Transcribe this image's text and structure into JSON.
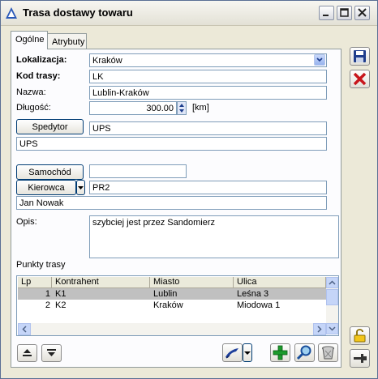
{
  "window": {
    "title": "Trasa dostawy towaru"
  },
  "tabs": [
    {
      "label": "Ogólne"
    },
    {
      "label": "Atrybuty"
    }
  ],
  "form": {
    "lokalizacja_label": "Lokalizacja:",
    "lokalizacja_value": "Kraków",
    "kod_label": "Kod trasy:",
    "kod_value": "LK",
    "nazwa_label": "Nazwa:",
    "nazwa_value": "Lublin-Kraków",
    "dlugosc_label": "Długość:",
    "dlugosc_value": "300.00",
    "dlugosc_unit": "[km]",
    "spedytor_button": "Spedytor",
    "spedytor_code": "UPS",
    "spedytor_name": "UPS",
    "samochod_button": "Samochód",
    "samochod_value": "",
    "kierowca_button": "Kierowca",
    "kierowca_code": "PR2",
    "kierowca_name": "Jan Nowak",
    "opis_label": "Opis:",
    "opis_value": "szybciej jest przez Sandomierz",
    "punkty_label": "Punkty trasy"
  },
  "grid": {
    "columns": [
      "Lp",
      "Kontrahent",
      "Miasto",
      "Ulica"
    ],
    "rows": [
      {
        "lp": "1",
        "kontrahent": "K1",
        "miasto": "Lublin",
        "ulica": "Leśna 3"
      },
      {
        "lp": "2",
        "kontrahent": "K2",
        "miasto": "Kraków",
        "ulica": "Miodowa 1"
      }
    ]
  },
  "colors": {
    "selected_row": "#c0c0c0",
    "accent": "#316ac5"
  }
}
